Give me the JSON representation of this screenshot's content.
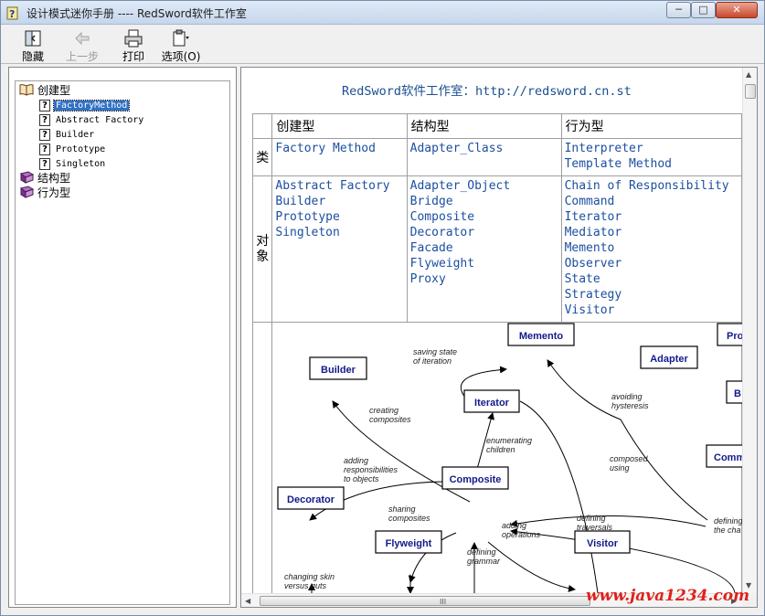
{
  "window": {
    "title": "设计模式迷你手册 ---- RedSword软件工作室",
    "controls": {
      "minimize": "─",
      "maximize": "□",
      "close": "✕"
    }
  },
  "toolbar": {
    "hide_label": "隐藏",
    "back_label": "上一步",
    "print_label": "打印",
    "options_label": "选项(O)"
  },
  "tree": {
    "creational": {
      "label": "创建型",
      "icon": "open-book-icon"
    },
    "children": [
      {
        "label": "FactoryMethod",
        "selected": true
      },
      {
        "label": "Abstract Factory"
      },
      {
        "label": "Builder"
      },
      {
        "label": "Prototype"
      },
      {
        "label": "Singleton"
      }
    ],
    "structural": {
      "label": "结构型",
      "icon": "closed-book-icon"
    },
    "behavioral": {
      "label": "行为型",
      "icon": "closed-book-icon"
    }
  },
  "content": {
    "heading": "RedSword软件工作室：http://redsword.cn.st",
    "table": {
      "headers": [
        "创建型",
        "结构型",
        "行为型"
      ],
      "class_row_label": "类",
      "object_row_label": "对象",
      "class_row": {
        "creational": [
          "Factory Method"
        ],
        "structural": [
          "Adapter_Class"
        ],
        "behavioral": [
          "Interpreter",
          "Template Method"
        ]
      },
      "object_row": {
        "creational": [
          "Abstract Factory",
          "Builder",
          "Prototype",
          "Singleton"
        ],
        "structural": [
          "Adapter_Object",
          "Bridge",
          "Composite",
          "Decorator",
          "Facade",
          "Flyweight",
          "Proxy"
        ],
        "behavioral": [
          "Chain of Responsibility",
          "Command",
          "Iterator",
          "Mediator",
          "Memento",
          "Observer",
          "State",
          "Strategy",
          "Visitor"
        ]
      }
    },
    "diagram": {
      "nodes": {
        "memento": "Memento",
        "builder": "Builder",
        "adapter": "Adapter",
        "iterator": "Iterator",
        "composite": "Composite",
        "decorator": "Decorator",
        "flyweight": "Flyweight",
        "visitor": "Visitor",
        "command": "Comm",
        "proxy": "Pro",
        "bridge": "B"
      },
      "edge_labels": {
        "saving_state_1": "saving state",
        "saving_state_2": "of iteration",
        "creating_1": "creating",
        "creating_2": "composites",
        "enumerating_1": "enumerating",
        "enumerating_2": "children",
        "avoiding_1": "avoiding",
        "avoiding_2": "hysteresis",
        "adding_resp_1": "adding",
        "adding_resp_2": "responsibilities",
        "adding_resp_3": "to objects",
        "composed_1": "composed",
        "composed_2": "using",
        "sharing_1": "sharing",
        "sharing_2": "composites",
        "adding_ops_1": "adding",
        "adding_ops_2": "operations",
        "defining_trav_1": "defining",
        "defining_trav_2": "traversals",
        "defining_chain_1": "defining",
        "defining_chain_2": "the cha",
        "defining_gram_1": "defining",
        "defining_gram_2": "grammar",
        "changing_skin_1": "changing skin",
        "changing_skin_2": "versus guts"
      }
    }
  },
  "scrollbar": {
    "grip": "III"
  },
  "watermark": "www.java1234.com"
}
